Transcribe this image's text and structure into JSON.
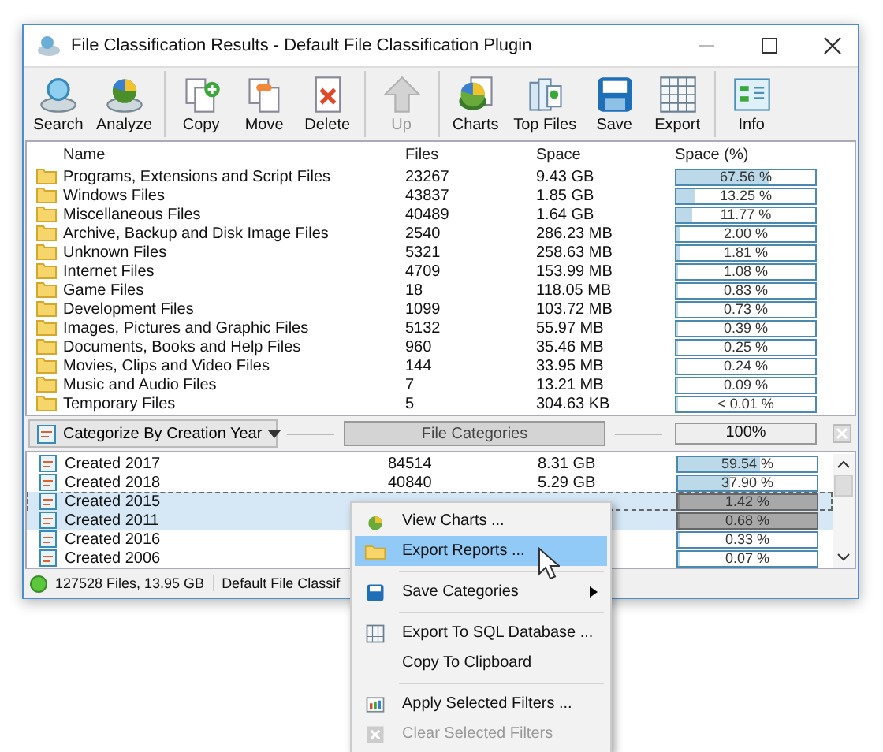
{
  "window": {
    "title": "File Classification Results - Default File Classification Plugin"
  },
  "toolbar_groups": [
    [
      {
        "label": "Search",
        "disabled": false
      },
      {
        "label": "Analyze",
        "disabled": false
      }
    ],
    [
      {
        "label": "Copy",
        "disabled": false
      },
      {
        "label": "Move",
        "disabled": false
      },
      {
        "label": "Delete",
        "disabled": false
      }
    ],
    [
      {
        "label": "Up",
        "disabled": true
      }
    ],
    [
      {
        "label": "Charts",
        "disabled": false
      },
      {
        "label": "Top Files",
        "disabled": false
      },
      {
        "label": "Save",
        "disabled": false
      },
      {
        "label": "Export",
        "disabled": false
      }
    ],
    [
      {
        "label": "Info",
        "disabled": false
      }
    ]
  ],
  "table": {
    "columns": [
      "Name",
      "Files",
      "Space",
      "Space (%)"
    ],
    "rows": [
      {
        "name": "Programs, Extensions and Script Files",
        "files": "23267",
        "space": "9.43 GB",
        "percent": "67.56 %",
        "level": 0.6756
      },
      {
        "name": "Windows Files",
        "files": "43837",
        "space": "1.85 GB",
        "percent": "13.25 %",
        "level": 0.1325
      },
      {
        "name": "Miscellaneous Files",
        "files": "40489",
        "space": "1.64 GB",
        "percent": "11.77 %",
        "level": 0.1177
      },
      {
        "name": "Archive, Backup and Disk Image Files",
        "files": "2540",
        "space": "286.23 MB",
        "percent": "2.00 %",
        "level": 0.02
      },
      {
        "name": "Unknown Files",
        "files": "5321",
        "space": "258.63 MB",
        "percent": "1.81 %",
        "level": 0.0181
      },
      {
        "name": "Internet Files",
        "files": "4709",
        "space": "153.99 MB",
        "percent": "1.08 %",
        "level": 0.0108
      },
      {
        "name": "Game Files",
        "files": "18",
        "space": "118.05 MB",
        "percent": "0.83 %",
        "level": 0.0083
      },
      {
        "name": "Development Files",
        "files": "1099",
        "space": "103.72 MB",
        "percent": "0.73 %",
        "level": 0.0073
      },
      {
        "name": "Images, Pictures and Graphic Files",
        "files": "5132",
        "space": "55.97 MB",
        "percent": "0.39 %",
        "level": 0.0039
      },
      {
        "name": "Documents, Books and Help Files",
        "files": "960",
        "space": "35.46 MB",
        "percent": "0.25 %",
        "level": 0.0025
      },
      {
        "name": "Movies, Clips and Video Files",
        "files": "144",
        "space": "33.95 MB",
        "percent": "0.24 %",
        "level": 0.0024
      },
      {
        "name": "Music and Audio Files",
        "files": "7",
        "space": "13.21 MB",
        "percent": "0.09 %",
        "level": 0.0009
      },
      {
        "name": "Temporary Files",
        "files": "5",
        "space": "304.63 KB",
        "percent": "< 0.01 %",
        "level": 0.0001
      }
    ]
  },
  "category_bar": {
    "dropdown": "Categorize By Creation Year",
    "button": "File Categories",
    "progress": "100%"
  },
  "category_table": {
    "rows": [
      {
        "name": "Created 2017",
        "files": "84514",
        "space": "8.31 GB",
        "percent": "59.54 %",
        "level": 0.5954,
        "selected": false
      },
      {
        "name": "Created 2018",
        "files": "40840",
        "space": "5.29 GB",
        "percent": "37.90 %",
        "level": 0.379,
        "selected": false
      },
      {
        "name": "Created 2015",
        "percent": "1.42 %",
        "level": 0.0142,
        "selected": true
      },
      {
        "name": "Created 2011",
        "percent": "0.68 %",
        "level": 0.0068,
        "selected": true
      },
      {
        "name": "Created 2016",
        "percent": "0.33 %",
        "level": 0.0033,
        "selected": false
      },
      {
        "name": "Created 2006",
        "percent": "0.07 %",
        "level": 0.0007,
        "selected": false
      }
    ]
  },
  "status_bar": {
    "summary": "127528 Files, 13.95 GB",
    "plugin": "Default File Classif"
  },
  "context_menu": [
    {
      "kind": "item",
      "label": "View Charts ...",
      "selected": false,
      "disabled": false,
      "submenu": false
    },
    {
      "kind": "item",
      "label": "Export Reports ...",
      "selected": true,
      "disabled": false,
      "submenu": false
    },
    {
      "kind": "separator"
    },
    {
      "kind": "item",
      "label": "Save Categories",
      "selected": false,
      "disabled": false,
      "submenu": true
    },
    {
      "kind": "separator"
    },
    {
      "kind": "item",
      "label": "Export To SQL Database ...",
      "selected": false,
      "disabled": false,
      "submenu": false
    },
    {
      "kind": "item",
      "label": "Copy To Clipboard",
      "selected": false,
      "disabled": false,
      "submenu": false
    },
    {
      "kind": "separator"
    },
    {
      "kind": "item",
      "label": "Apply Selected Filters ...",
      "selected": false,
      "disabled": false,
      "submenu": false
    },
    {
      "kind": "item",
      "label": "Clear Selected Filters",
      "selected": false,
      "disabled": true,
      "submenu": false
    }
  ]
}
